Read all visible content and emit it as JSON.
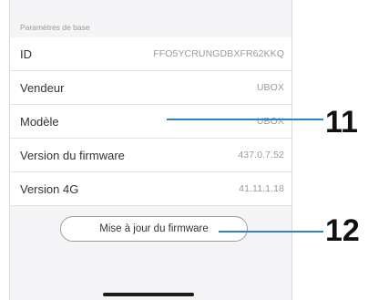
{
  "section": {
    "header": "Paramètres de base"
  },
  "rows": [
    {
      "label": "ID",
      "value": "FFO5YCRUNGDBXFR62KKQ"
    },
    {
      "label": "Vendeur",
      "value": "UBOX"
    },
    {
      "label": "Modèle",
      "value": "UBOX"
    },
    {
      "label": "Version du firmware",
      "value": "437.0.7.52"
    },
    {
      "label": "Version 4G",
      "value": "41.11.1.18"
    }
  ],
  "update_button": {
    "label": "Mise à jour du firmware"
  },
  "callouts": [
    {
      "number": "11"
    },
    {
      "number": "12"
    }
  ],
  "colors": {
    "panel_background": "#f4f4f6",
    "callout_line": "#2a87c7",
    "secondary_text": "#9a9a9a"
  }
}
